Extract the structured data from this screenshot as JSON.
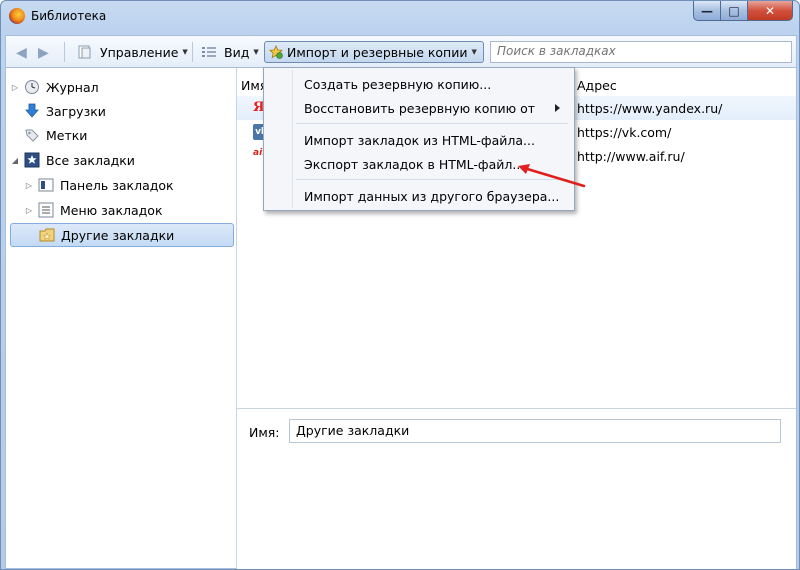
{
  "window": {
    "title": "Библиотека"
  },
  "toolbar": {
    "manage_label": "Управление",
    "view_label": "Вид",
    "import_label": "Импорт и резервные копии",
    "search_placeholder": "Поиск в закладках"
  },
  "sidebar": {
    "items": [
      {
        "label": "Журнал"
      },
      {
        "label": "Загрузки"
      },
      {
        "label": "Метки"
      },
      {
        "label": "Все закладки"
      },
      {
        "label": "Панель закладок"
      },
      {
        "label": "Меню закладок"
      },
      {
        "label": "Другие закладки"
      }
    ]
  },
  "list": {
    "columns": [
      "Имя",
      "Адрес"
    ],
    "rows": [
      {
        "icon": "Я",
        "url": "https://www.yandex.ru/"
      },
      {
        "icon": "vk",
        "url": "https://vk.com/"
      },
      {
        "icon": "aif",
        "url": "http://www.aif.ru/"
      }
    ]
  },
  "menu": {
    "items": [
      {
        "label": "Создать резервную копию..."
      },
      {
        "label": "Восстановить резервную копию от"
      },
      {
        "label": "Импорт закладок из HTML-файла..."
      },
      {
        "label": "Экспорт закладок в HTML-файл..."
      },
      {
        "label": "Импорт данных из другого браузера..."
      }
    ]
  },
  "detail": {
    "name_label": "Имя:",
    "name_value": "Другие закладки"
  },
  "colors": {
    "annotation_arrow": "#e0201c",
    "selection": "#c4daf4"
  }
}
